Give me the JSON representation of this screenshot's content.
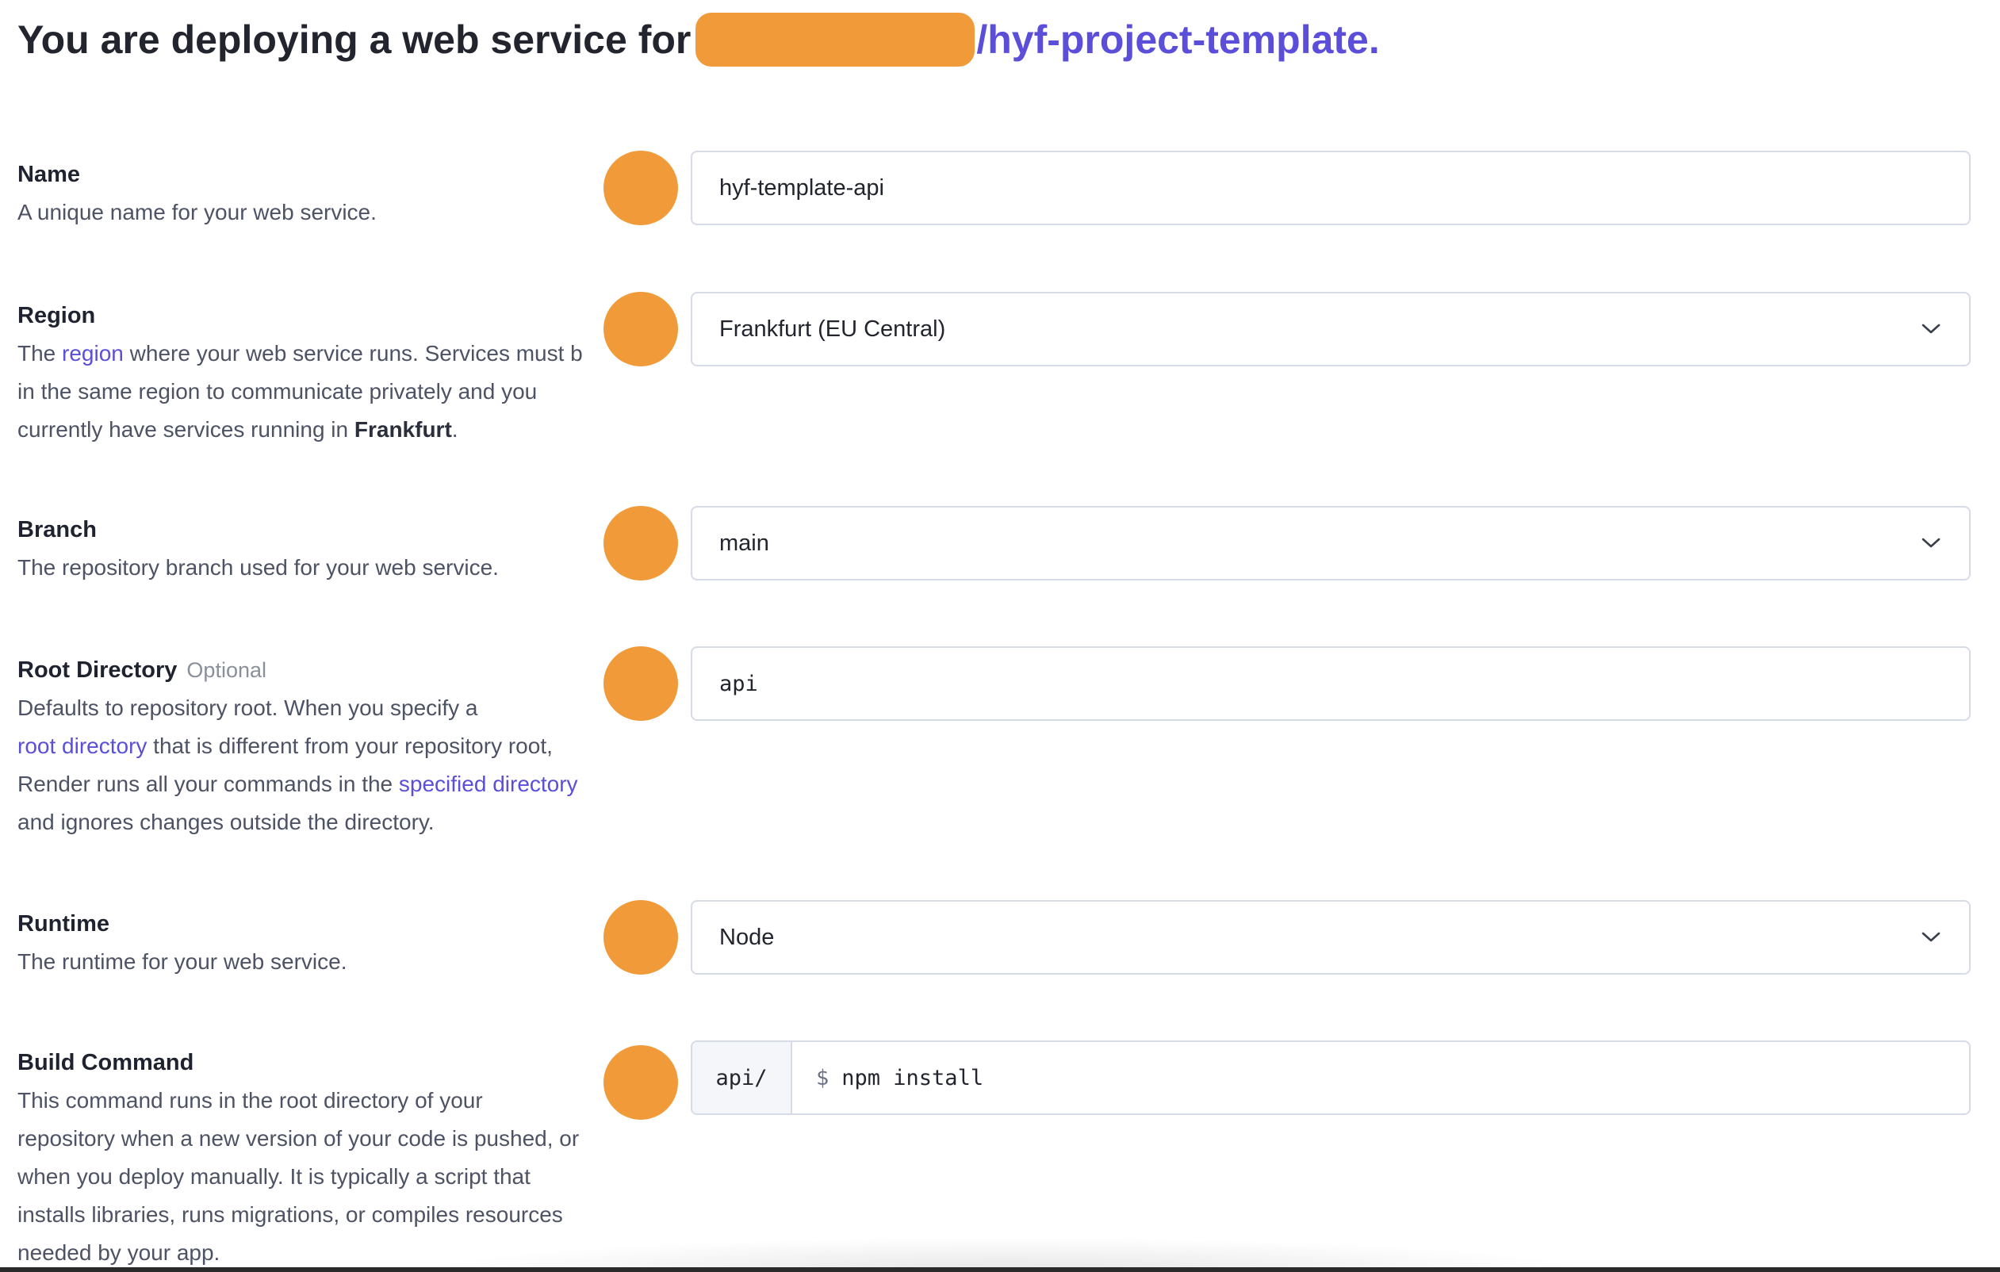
{
  "header": {
    "prefix": "You are deploying a web service for",
    "repo": "/hyf-project-template."
  },
  "fields": {
    "name": {
      "title": "Name",
      "description": "A unique name for your web service.",
      "value": "hyf-template-api"
    },
    "region": {
      "title": "Region",
      "desc_1": "The ",
      "desc_link": "region",
      "desc_2": " where your web service runs. Services must b",
      "desc_3": "in the same region to communicate privately and you",
      "desc_4": "currently have services running in ",
      "desc_bold": "Frankfurt",
      "desc_5": ".",
      "value": "Frankfurt (EU Central)"
    },
    "branch": {
      "title": "Branch",
      "description": "The repository branch used for your web service.",
      "value": "main"
    },
    "root_directory": {
      "title": "Root Directory",
      "optional": "Optional",
      "desc_1": "Defaults to repository root. When you specify a",
      "desc_link_1": "root directory",
      "desc_2": " that is different from your repository root,",
      "desc_3": "Render runs all your commands in the ",
      "desc_link_2": "specified directory",
      "desc_4": "and ignores changes outside the directory.",
      "value": "api"
    },
    "runtime": {
      "title": "Runtime",
      "description": "The runtime for your web service.",
      "value": "Node"
    },
    "build_command": {
      "title": "Build Command",
      "desc_1": "This command runs in the root directory of your",
      "desc_2": "repository when a new version of your code is pushed, or",
      "desc_3": "when you deploy manually. It is typically a script that",
      "desc_4": "installs libraries, runs migrations, or compiles resources",
      "desc_5": "needed by your app.",
      "prefix": "api/",
      "prompt": "$",
      "value": "npm install"
    }
  },
  "colors": {
    "accent": "#5b4fd9",
    "marker": "#f09a3a",
    "border": "#d7dbe6",
    "text": "#1f2330",
    "muted": "#4d5365"
  },
  "icons": {
    "dropdown": "chevron-down-icon"
  }
}
